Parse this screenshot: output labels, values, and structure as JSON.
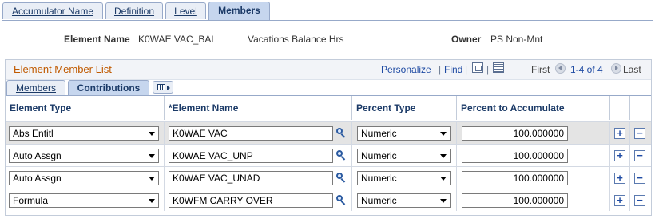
{
  "page_tabs": [
    {
      "label": "Accumulator Name",
      "active": false
    },
    {
      "label": "Definition",
      "active": false
    },
    {
      "label": "Level",
      "active": false
    },
    {
      "label": "Members",
      "active": true
    }
  ],
  "header": {
    "element_label": "Element Name",
    "element_value": "K0WAE VAC_BAL",
    "element_desc": "Vacations Balance Hrs",
    "owner_label": "Owner",
    "owner_value": "PS Non-Mnt"
  },
  "grid": {
    "title": "Element Member List",
    "personalize": "Personalize",
    "separator": "|",
    "find": "Find",
    "first": "First",
    "range": "1-4 of 4",
    "last": "Last",
    "tabs": [
      {
        "label": "Members",
        "active": false
      },
      {
        "label": "Contributions",
        "active": true
      }
    ],
    "columns": [
      "Element Type",
      "*Element Name",
      "Percent Type",
      "Percent to Accumulate"
    ],
    "rows": [
      {
        "type": "Abs Entitl",
        "name": "K0WAE VAC",
        "percent_type": "Numeric",
        "percent": "100.000000"
      },
      {
        "type": "Auto Assgn",
        "name": "K0WAE VAC_UNP",
        "percent_type": "Numeric",
        "percent": "100.000000"
      },
      {
        "type": "Auto Assgn",
        "name": "K0WAE VAC_UNAD",
        "percent_type": "Numeric",
        "percent": "100.000000"
      },
      {
        "type": "Formula",
        "name": "K0WFM CARRY OVER",
        "percent_type": "Numeric",
        "percent": "100.000000"
      }
    ],
    "add_symbol": "+",
    "delete_symbol": "−"
  },
  "colors": {
    "title_orange": "#c05a00",
    "link_blue": "#1f4ba3",
    "tab_active": "#c6d6ee",
    "row_selected": "#e4e4e4"
  }
}
